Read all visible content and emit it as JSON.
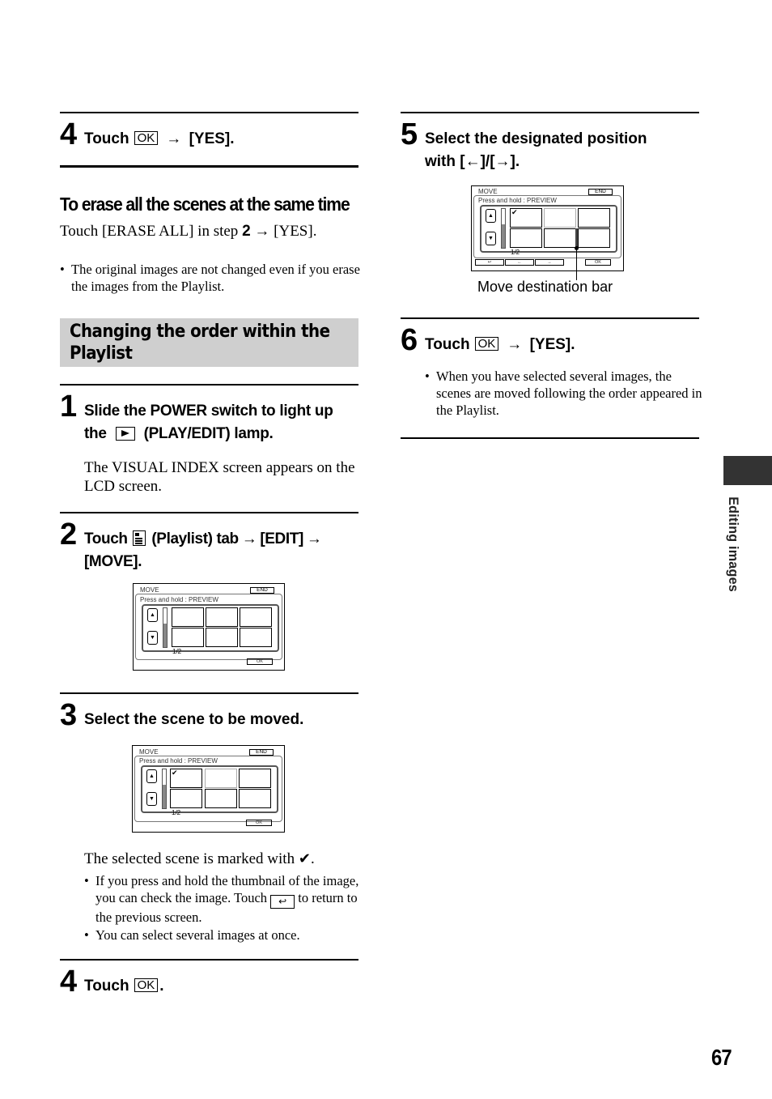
{
  "left_column": {
    "step4_top": {
      "number": "4",
      "prefix": "Touch",
      "ok_label": "OK",
      "arrow": "→",
      "suffix": "[YES]."
    },
    "erase_all": {
      "heading": "To erase all the scenes at the same time",
      "text_before": "Touch [ERASE ALL] in step ",
      "step_ref": "2",
      "arrow": "→",
      "text_after": " [YES].",
      "bullet": "The original images are not changed even if you erase the images from the Playlist."
    },
    "section": {
      "title_line1": "Changing the order within the",
      "title_line2": "Playlist"
    },
    "step1": {
      "number": "1",
      "line1": "Slide the POWER switch to light up",
      "line2_prefix": "the",
      "icon": "play-edit-icon",
      "line2_suffix": "(PLAY/EDIT) lamp.",
      "body": "The VISUAL INDEX screen appears on the LCD screen."
    },
    "step2": {
      "number": "2",
      "prefix": "Touch",
      "icon": "playlist-icon",
      "middle": "(Playlist) tab",
      "arrow": "→",
      "edit": "[EDIT]",
      "move": "[MOVE]."
    },
    "step3": {
      "number": "3",
      "title": "Select the scene to be moved.",
      "selected_text": "The selected scene is marked with",
      "check_glyph": "✔",
      "bullets": [
        {
          "text_before": "If you press and hold the thumbnail of the image, you can check the image. Touch",
          "icon": "return-icon",
          "text_after": "to return to the previous screen."
        },
        {
          "text": "You can select several images at once."
        }
      ]
    },
    "step4_bottom": {
      "number": "4",
      "prefix": "Touch",
      "ok_label": "OK",
      "suffix": "."
    }
  },
  "right_column": {
    "step5": {
      "number": "5",
      "line1": "Select the designated position",
      "line2": "with [←]/[→].",
      "callout": "Move destination bar"
    },
    "step6": {
      "number": "6",
      "prefix": "Touch",
      "ok_label": "OK",
      "arrow": "→",
      "suffix": "[YES].",
      "bullet": "When you have selected several images, the scenes are moved following the order appeared in the Playlist."
    }
  },
  "lcd_screen": {
    "title": "MOVE",
    "end_label": "END",
    "press_hint": "Press and hold : PREVIEW",
    "up_glyph": "▲",
    "down_glyph": "▼",
    "page": "1/2",
    "ok_label": "OK",
    "return_glyph": "↩",
    "left_glyph": "←",
    "right_glyph": "→"
  },
  "side_tab": {
    "label": "Editing images"
  },
  "page_number": "67"
}
